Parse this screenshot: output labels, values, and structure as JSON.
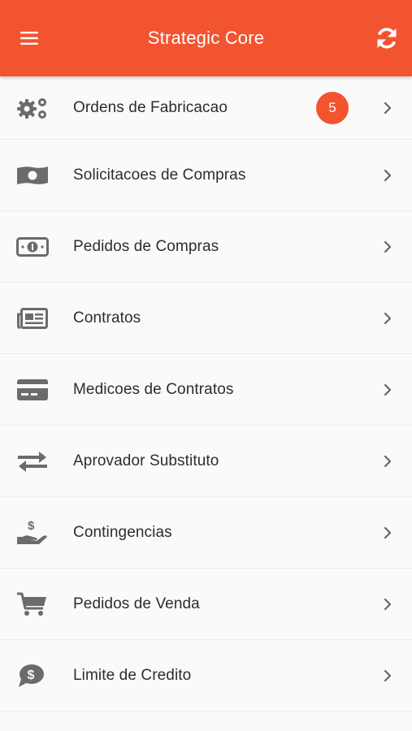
{
  "appbar": {
    "title": "Strategic Core",
    "menu_icon": "hamburger-menu-icon",
    "refresh_icon": "refresh-icon",
    "color": "#f35430"
  },
  "menu": {
    "items": [
      {
        "label": "Ordens de Fabricacao",
        "icon": "gears-icon",
        "badge": "5"
      },
      {
        "label": "Solicitacoes de Compras",
        "icon": "money-bill-icon"
      },
      {
        "label": "Pedidos de Compras",
        "icon": "money-bill-alt-icon"
      },
      {
        "label": "Contratos",
        "icon": "newspaper-icon"
      },
      {
        "label": "Medicoes de Contratos",
        "icon": "credit-card-icon"
      },
      {
        "label": "Aprovador Substituto",
        "icon": "exchange-arrows-icon"
      },
      {
        "label": "Contingencias",
        "icon": "hand-holding-dollar-icon"
      },
      {
        "label": "Pedidos de Venda",
        "icon": "shopping-cart-icon"
      },
      {
        "label": "Limite de Credito",
        "icon": "dollar-comment-icon"
      }
    ]
  }
}
